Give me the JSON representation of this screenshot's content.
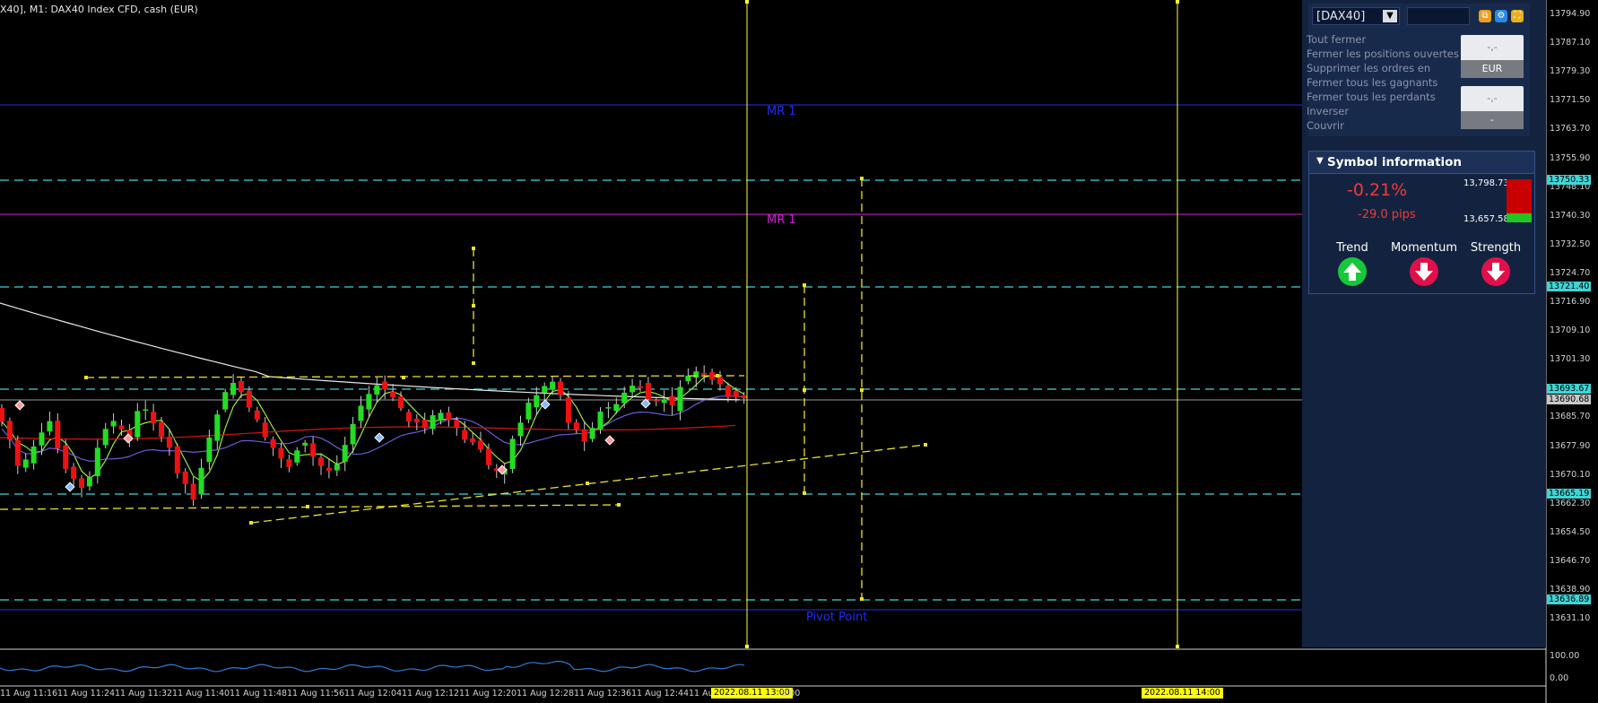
{
  "window_title": "X40], M1:  DAX40 Index CFD, cash (EUR)",
  "colors": {
    "background": "#000000",
    "panel": "#13233f",
    "bull": "#22dd22",
    "bear": "#ee1111",
    "level_cyan": "#3fd5d5",
    "level_yellow": "#ffff33"
  },
  "levels": [
    {
      "text": "MR 1",
      "color": "#1f2ff0"
    },
    {
      "text": "MR 1",
      "color": "#d61ed6"
    },
    {
      "text": "Pivot Point",
      "color": "#1f2ff0"
    }
  ],
  "price_axis": {
    "labels": [
      "13794.90",
      "13787.10",
      "13779.30",
      "13771.50",
      "13763.70",
      "13755.90",
      "13748.10",
      "13740.30",
      "13732.50",
      "13724.70",
      "13716.90",
      "13709.10",
      "13701.30",
      "13685.70",
      "13677.90",
      "13670.10",
      "13662.30",
      "13654.50",
      "13646.70",
      "13638.90",
      "13631.10"
    ],
    "tags": [
      {
        "text": "13750.33",
        "color": "#3fd5d5"
      },
      {
        "text": "13721.40",
        "color": "#3fd5d5"
      },
      {
        "text": "13693.67",
        "color": "#3fd5d5"
      },
      {
        "text": "13690.68",
        "color": "#c8c8c8"
      },
      {
        "text": "13665.19",
        "color": "#3fd5d5"
      },
      {
        "text": "13636.89",
        "color": "#3fd5d5"
      }
    ],
    "sub_labels": [
      "100.00",
      "0.00"
    ]
  },
  "time_axis": {
    "labels": [
      "11 Aug 11:16",
      "11 Aug 11:24",
      "11 Aug 11:32",
      "11 Aug 11:40",
      "11 Aug 11:48",
      "11 Aug 11:56",
      "11 Aug 12:04",
      "11 Aug 12:12",
      "11 Aug 12:20",
      "11 Aug 12:28",
      "11 Aug 12:36",
      "11 Aug 12:44",
      "11 Au"
    ],
    "cursor_tags": [
      "2022.08.11 13:00",
      "2022.08.11 14:00"
    ],
    "tail_label": "3:00"
  },
  "trade_panel": {
    "symbol": "[DAX40]",
    "menu": [
      "Tout fermer",
      "Fermer les positions ouvertes",
      "Supprimer les ordres en",
      "Fermer tous les gagnants",
      "Fermer tous les perdants",
      "Inverser",
      "Couvrir"
    ],
    "btn1_value": "-,-",
    "btn1_currency": "EUR",
    "btn2_value": "-,-",
    "btn2_sub": "-"
  },
  "symbol_info": {
    "title": "Symbol information",
    "change_pct": "-0.21%",
    "change_pips": "-29.0 pips",
    "high": "13,798.73",
    "low": "13,657.58",
    "indicators": [
      {
        "label": "Trend",
        "direction": "up",
        "color": "#16c83a"
      },
      {
        "label": "Momentum",
        "direction": "down",
        "color": "#e0104a"
      },
      {
        "label": "Strength",
        "direction": "down",
        "color": "#e0104a"
      }
    ]
  }
}
